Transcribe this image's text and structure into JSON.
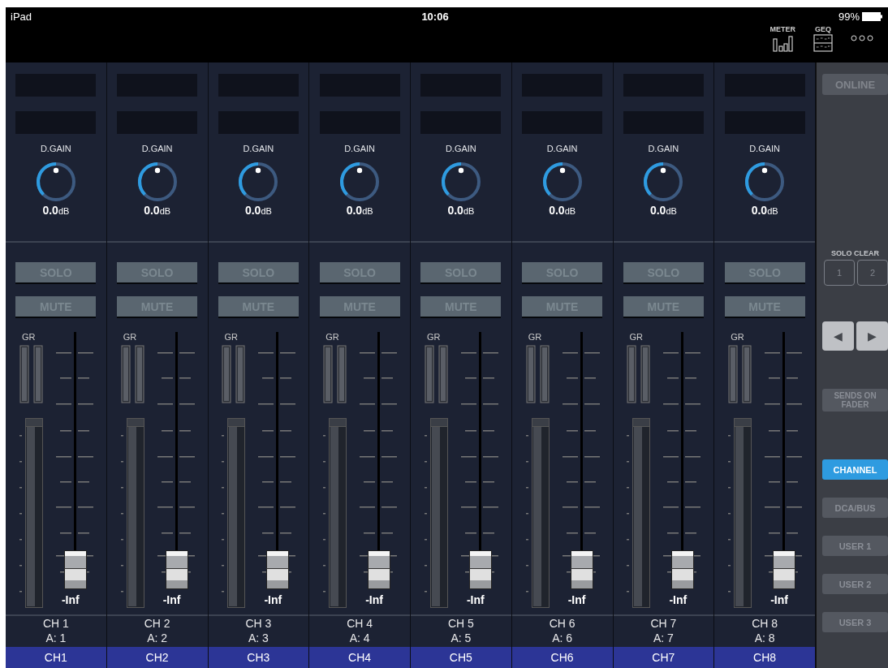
{
  "status_bar": {
    "device": "iPad",
    "time": "10:06",
    "battery": "99%"
  },
  "toolbar": [
    {
      "label": "METER",
      "kind": "meter"
    },
    {
      "label": "GEQ",
      "kind": "geq"
    },
    {
      "kind": "more"
    }
  ],
  "channels": [
    {
      "gain_label": "D.GAIN",
      "gain": "**0.0**dB",
      "solo": {
        "label": "SOLO",
        "on": false
      },
      "mute": {
        "label": "MUTE",
        "on": false
      },
      "gr_label": "GR",
      "reading": "-Inf",
      "name": "CH 1",
      "assign": "A: 1",
      "tag": "CH1"
    },
    {
      "gain_label": "D.GAIN",
      "gain": "**0.0**dB",
      "solo": {
        "label": "SOLO",
        "on": false
      },
      "mute": {
        "label": "MUTE",
        "on": false
      },
      "gr_label": "GR",
      "reading": "-Inf",
      "name": "CH 2",
      "assign": "A: 2",
      "tag": "CH2"
    },
    {
      "gain_label": "D.GAIN",
      "gain": "**0.0**dB",
      "solo": {
        "label": "SOLO",
        "on": false
      },
      "mute": {
        "label": "MUTE",
        "on": false
      },
      "gr_label": "GR",
      "reading": "-Inf",
      "name": "CH 3",
      "assign": "A: 3",
      "tag": "CH3"
    },
    {
      "gain_label": "D.GAIN",
      "gain": "**0.0**dB",
      "solo": {
        "label": "SOLO",
        "on": false
      },
      "mute": {
        "label": "MUTE",
        "on": false
      },
      "gr_label": "GR",
      "reading": "-Inf",
      "name": "CH 4",
      "assign": "A: 4",
      "tag": "CH4"
    },
    {
      "gain_label": "D.GAIN",
      "gain": "**0.0**dB",
      "solo": {
        "label": "SOLO",
        "on": false
      },
      "mute": {
        "label": "MUTE",
        "on": false
      },
      "gr_label": "GR",
      "reading": "-Inf",
      "name": "CH 5",
      "assign": "A: 5",
      "tag": "CH5"
    },
    {
      "gain_label": "D.GAIN",
      "gain": "**0.0**dB",
      "solo": {
        "label": "SOLO",
        "on": false
      },
      "mute": {
        "label": "MUTE",
        "on": false
      },
      "gr_label": "GR",
      "reading": "-Inf",
      "name": "CH 6",
      "assign": "A: 6",
      "tag": "CH6"
    },
    {
      "gain_label": "D.GAIN",
      "gain": "**0.0**dB",
      "solo": {
        "label": "SOLO",
        "on": false
      },
      "mute": {
        "label": "MUTE",
        "on": false
      },
      "gr_label": "GR",
      "reading": "-Inf",
      "name": "CH 7",
      "assign": "A: 7",
      "tag": "CH7"
    },
    {
      "gain_label": "D.GAIN",
      "gain": "**0.0**dB",
      "solo": {
        "label": "SOLO",
        "on": false
      },
      "mute": {
        "label": "MUTE",
        "on": false
      },
      "gr_label": "GR",
      "reading": "-Inf",
      "name": "CH 8",
      "assign": "A: 8",
      "tag": "CH8"
    }
  ],
  "side_panel": {
    "online": "ONLINE",
    "solo_clear": {
      "label": "SOLO CLEAR",
      "buttons": [
        "1",
        "2"
      ]
    },
    "arrows": [
      {
        "label": "◀"
      },
      {
        "label": "▶"
      }
    ],
    "sends_on_fader": "SENDS ON FADER",
    "layers": [
      {
        "label": "CHANNEL",
        "selected": true
      },
      {
        "label": "DCA/BUS",
        "selected": false
      },
      {
        "label": "USER 1",
        "selected": false
      },
      {
        "label": "USER 2",
        "selected": false
      },
      {
        "label": "USER 3",
        "selected": false
      }
    ]
  }
}
